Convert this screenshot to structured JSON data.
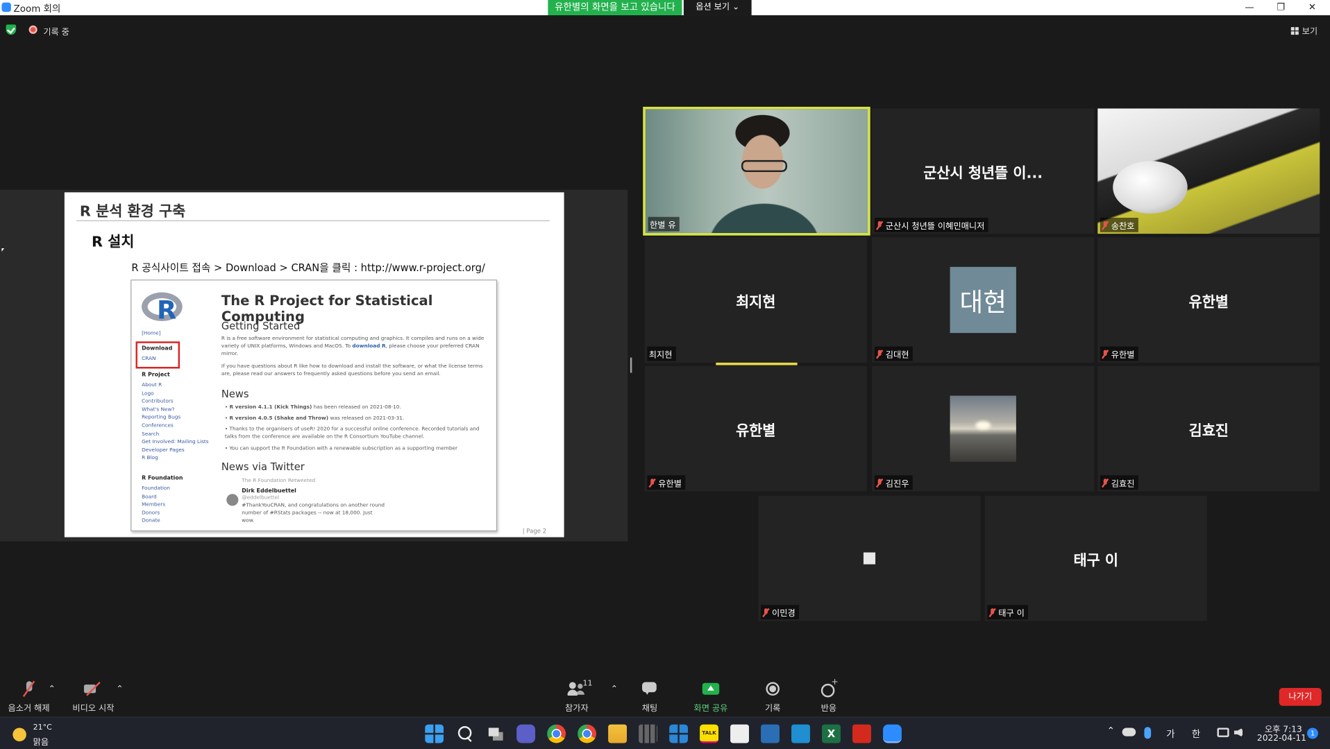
{
  "window": {
    "title": "Zoom 회의",
    "share_banner": "유한별의 화면을 보고 있습니다",
    "options_label": "옵션 보기 ⌄",
    "minimize": "—",
    "restore": "❐",
    "close": "✕"
  },
  "topbar": {
    "recording_label": "기록 중",
    "view_label": "보기"
  },
  "slide": {
    "title": "R 분석 환경 구축",
    "subtitle": "R 설치",
    "instruction": "R 공식사이트 접속 > Download > CRAN을 클릭 : http://www.r-project.org/",
    "page": "|   Page 2",
    "site": {
      "logo_letter": "R",
      "heading": "The R Project for Statistical Computing",
      "sidebar": {
        "home": "[Home]",
        "download": "Download",
        "cran": "CRAN",
        "project_head": "R Project",
        "project_links": [
          "About R",
          "Logo",
          "Contributors",
          "What's New?",
          "Reporting Bugs",
          "Conferences",
          "Search",
          "Get Involved: Mailing Lists",
          "Developer Pages",
          "R Blog"
        ],
        "foundation_head": "R Foundation",
        "foundation_links": [
          "Foundation",
          "Board",
          "Members",
          "Donors",
          "Donate"
        ]
      },
      "getting_started": "Getting Started",
      "gs_para1_a": "R is a free software environment for statistical computing and graphics. It compiles and runs on a wide variety of UNIX platforms, Windows and MacOS. To ",
      "gs_para1_link": "download R",
      "gs_para1_b": ", please choose your preferred CRAN mirror.",
      "gs_para2": "If you have questions about R like how to download and install the software, or what the license terms are, please read our answers to frequently asked questions before you send an email.",
      "news_head": "News",
      "news_items": [
        {
          "link": "R version 4.1.1 (Kick Things)",
          "text": " has been released on 2021-08-10."
        },
        {
          "link": "R version 4.0.5 (Shake and Throw)",
          "text": " was released on 2021-03-31."
        },
        {
          "link": "",
          "text": "Thanks to the organisers of useR! 2020 for a successful online conference. Recorded tutorials and talks from the conference are available on the R Consortium YouTube channel."
        },
        {
          "link": "",
          "text": "You can support the R Foundation with a renewable subscription as a supporting member"
        }
      ],
      "twitter_head": "News via Twitter",
      "tweet_retweeted": "The R Foundation Retweeted",
      "tweet_author": "Dirk Eddelbuettel",
      "tweet_handle": "@eddelbuettel",
      "tweet_text": "#ThankYouCRAN, and congratulations on another round number of #RStats packages -- now at 18,000. Just wow."
    }
  },
  "tiles": [
    {
      "name": "",
      "label": "한별 유",
      "muted": false,
      "kind": "camera-person"
    },
    {
      "name": "군산시 청년뜰 이...",
      "label": "군산시 청년뜰 이혜민매니저",
      "muted": true,
      "kind": "name"
    },
    {
      "name": "",
      "label": "송찬호",
      "muted": true,
      "kind": "camera-desk"
    },
    {
      "name": "최지현",
      "label": "최지현",
      "muted": false,
      "kind": "name"
    },
    {
      "name": "대현",
      "label": "김대현",
      "muted": true,
      "kind": "avatar"
    },
    {
      "name": "유한별",
      "label": "유한별",
      "muted": true,
      "kind": "name"
    },
    {
      "name": "유한별",
      "label": "유한별",
      "muted": true,
      "kind": "name"
    },
    {
      "name": "",
      "label": "김진우",
      "muted": true,
      "kind": "photo"
    },
    {
      "name": "김효진",
      "label": "김효진",
      "muted": true,
      "kind": "name"
    },
    {
      "name": "",
      "label": "이민경",
      "muted": true,
      "kind": "square"
    },
    {
      "name": "태구 이",
      "label": "태구 이",
      "muted": true,
      "kind": "name"
    }
  ],
  "toolbar": {
    "mute": "음소거 해제",
    "video": "비디오 시작",
    "participants": "참가자",
    "participant_count": "11",
    "chat": "채팅",
    "share": "화면 공유",
    "record": "기록",
    "reactions": "반응",
    "leave": "나가기",
    "caret": "⌃"
  },
  "taskbar": {
    "temperature": "21°C",
    "weather": "맑음",
    "ime_lang": "가",
    "ime_mode": "한",
    "time": "오후 7:13",
    "date": "2022-04-11",
    "notifications": "1",
    "up_arrow": "⌃",
    "talk": "TALK"
  },
  "colors": {
    "share_green": "#23b14d",
    "active_speaker": "#d6e34a",
    "leave_red": "#e02828",
    "muted_red": "#e5534b",
    "r_blue": "#2165b6"
  }
}
